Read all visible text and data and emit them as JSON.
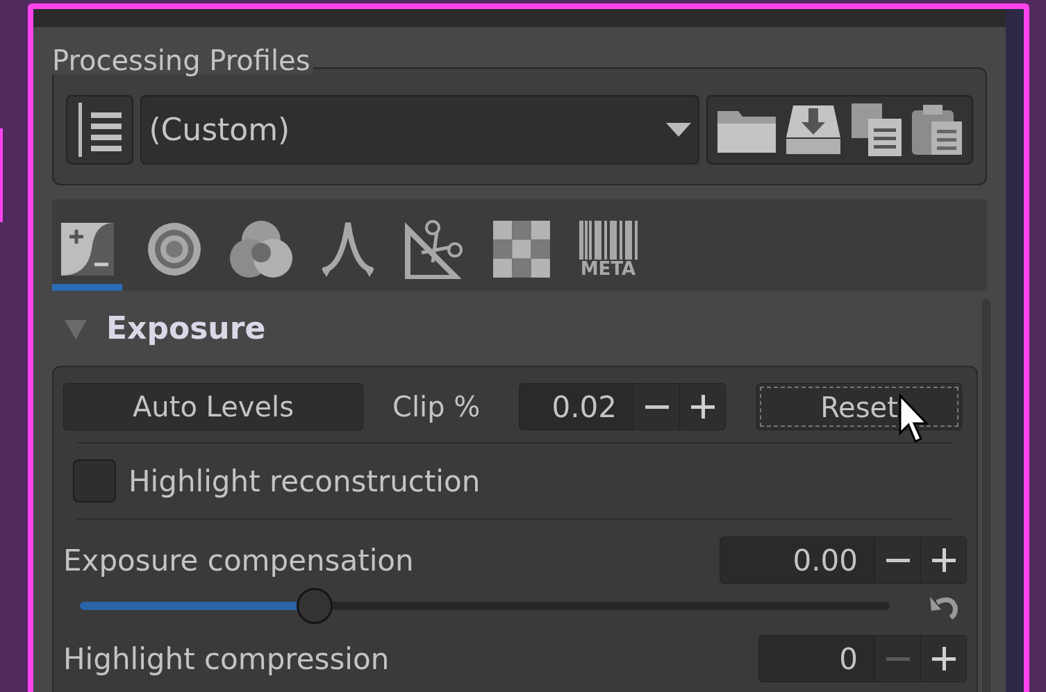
{
  "profiles": {
    "title": "Processing Profiles",
    "selected_profile": "(Custom)"
  },
  "tabs": [
    {
      "kind": "exposure",
      "selected": true
    },
    {
      "kind": "detail",
      "selected": false
    },
    {
      "kind": "color",
      "selected": false
    },
    {
      "kind": "advanced",
      "selected": false
    },
    {
      "kind": "transform",
      "selected": false
    },
    {
      "kind": "raw",
      "selected": false
    },
    {
      "kind": "metadata",
      "label": "META",
      "selected": false
    }
  ],
  "section": {
    "title": "Exposure",
    "expanded": true,
    "auto_levels": "Auto Levels",
    "clip_label": "Clip %",
    "clip_value": "0.02",
    "reset": "Reset",
    "reset_focused": true,
    "checkbox": {
      "label": "Highlight reconstruction",
      "checked": false
    },
    "sliders": [
      {
        "label": "Exposure compensation",
        "value": "0.00",
        "level": 0.29,
        "show_slider": true,
        "minus_disabled": false
      },
      {
        "label": "Highlight compression",
        "value": "0",
        "show_slider": false,
        "minus_disabled": true
      }
    ]
  }
}
